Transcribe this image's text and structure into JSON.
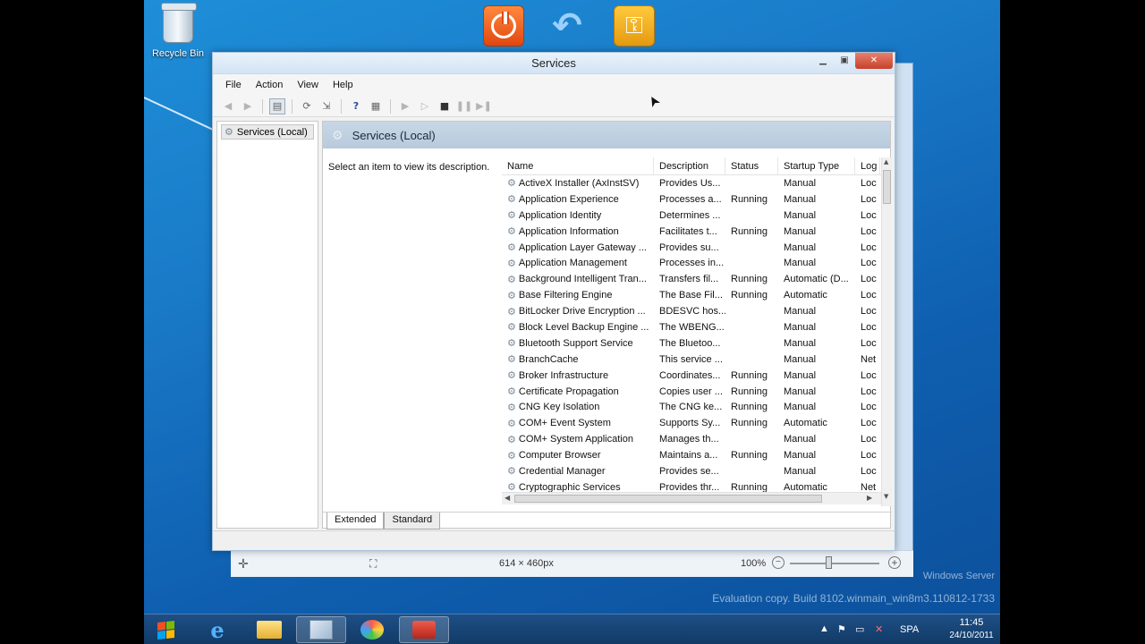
{
  "desktop": {
    "recycle_bin_label": "Recycle Bin",
    "watermark_line1": "Windows Server",
    "watermark_line2": "Evaluation copy. Build 8102.winmain_win8m3.110812-1733"
  },
  "back_window_status": {
    "dimensions": "614 × 460px",
    "zoom": "100%"
  },
  "window": {
    "title": "Services",
    "menu": [
      "File",
      "Action",
      "View",
      "Help"
    ],
    "tree_node": "Services (Local)",
    "pane_title": "Services (Local)",
    "description_hint": "Select an item to view its description.",
    "columns": {
      "name": "Name",
      "description": "Description",
      "status": "Status",
      "startup": "Startup Type",
      "logon": "Log"
    },
    "rows": [
      {
        "name": "ActiveX Installer (AxInstSV)",
        "description": "Provides Us...",
        "status": "",
        "startup": "Manual",
        "logon": "Loc"
      },
      {
        "name": "Application Experience",
        "description": "Processes a...",
        "status": "Running",
        "startup": "Manual",
        "logon": "Loc"
      },
      {
        "name": "Application Identity",
        "description": "Determines ...",
        "status": "",
        "startup": "Manual",
        "logon": "Loc"
      },
      {
        "name": "Application Information",
        "description": "Facilitates t...",
        "status": "Running",
        "startup": "Manual",
        "logon": "Loc"
      },
      {
        "name": "Application Layer Gateway ...",
        "description": "Provides su...",
        "status": "",
        "startup": "Manual",
        "logon": "Loc"
      },
      {
        "name": "Application Management",
        "description": "Processes in...",
        "status": "",
        "startup": "Manual",
        "logon": "Loc"
      },
      {
        "name": "Background Intelligent Tran...",
        "description": "Transfers fil...",
        "status": "Running",
        "startup": "Automatic (D...",
        "logon": "Loc"
      },
      {
        "name": "Base Filtering Engine",
        "description": "The Base Fil...",
        "status": "Running",
        "startup": "Automatic",
        "logon": "Loc"
      },
      {
        "name": "BitLocker Drive Encryption ...",
        "description": "BDESVC hos...",
        "status": "",
        "startup": "Manual",
        "logon": "Loc"
      },
      {
        "name": "Block Level Backup Engine ...",
        "description": "The WBENG...",
        "status": "",
        "startup": "Manual",
        "logon": "Loc"
      },
      {
        "name": "Bluetooth Support Service",
        "description": "The Bluetoo...",
        "status": "",
        "startup": "Manual",
        "logon": "Loc"
      },
      {
        "name": "BranchCache",
        "description": "This service ...",
        "status": "",
        "startup": "Manual",
        "logon": "Net"
      },
      {
        "name": "Broker Infrastructure",
        "description": "Coordinates...",
        "status": "Running",
        "startup": "Manual",
        "logon": "Loc"
      },
      {
        "name": "Certificate Propagation",
        "description": "Copies user ...",
        "status": "Running",
        "startup": "Manual",
        "logon": "Loc"
      },
      {
        "name": "CNG Key Isolation",
        "description": "The CNG ke...",
        "status": "Running",
        "startup": "Manual",
        "logon": "Loc"
      },
      {
        "name": "COM+ Event System",
        "description": "Supports Sy...",
        "status": "Running",
        "startup": "Automatic",
        "logon": "Loc"
      },
      {
        "name": "COM+ System Application",
        "description": "Manages th...",
        "status": "",
        "startup": "Manual",
        "logon": "Loc"
      },
      {
        "name": "Computer Browser",
        "description": "Maintains a...",
        "status": "Running",
        "startup": "Manual",
        "logon": "Loc"
      },
      {
        "name": "Credential Manager",
        "description": "Provides se...",
        "status": "",
        "startup": "Manual",
        "logon": "Loc"
      },
      {
        "name": "Cryptographic Services",
        "description": "Provides thr...",
        "status": "Running",
        "startup": "Automatic",
        "logon": "Net"
      }
    ],
    "tabs": [
      "Extended",
      "Standard"
    ]
  },
  "tray": {
    "language": "SPA",
    "time": "11:45",
    "date": "24/10/2011"
  },
  "icons": {
    "top_shortcuts": [
      "power-icon",
      "undo-icon",
      "key-icon"
    ],
    "taskbar": [
      "start-orb-icon",
      "internet-explorer-icon",
      "folder-icon",
      "image-viewer-icon",
      "paint-icon",
      "toolbox-icon"
    ]
  },
  "colors": {
    "desktop_blue": "#1a7cc9",
    "taskbar": "#123a66",
    "close_button": "#c7402a"
  }
}
